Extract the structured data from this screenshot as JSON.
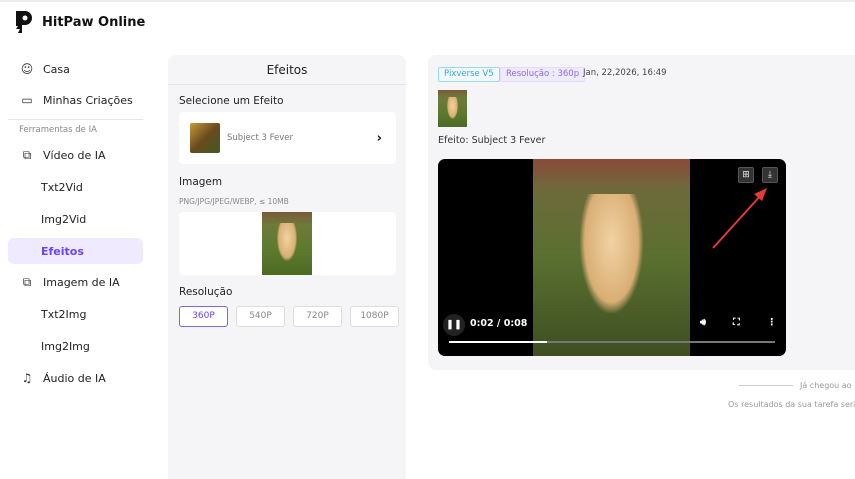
{
  "app": {
    "name": "HitPaw Online"
  },
  "sidebar": {
    "items": [
      {
        "label": "Casa",
        "icon": "home-face-icon"
      },
      {
        "label": "Minhas Criações",
        "icon": "folder-icon"
      }
    ],
    "section_label": "Ferramentas de IA",
    "tools": [
      {
        "label": "Vídeo de IA",
        "icon": "video-ai-icon"
      },
      {
        "label": "Txt2Vid"
      },
      {
        "label": "Img2Vid"
      },
      {
        "label": "Efeitos",
        "active": true
      },
      {
        "label": "Imagem de IA",
        "icon": "image-ai-icon"
      },
      {
        "label": "Txt2Img"
      },
      {
        "label": "Img2Img"
      },
      {
        "label": "Áudio de IA",
        "icon": "music-note-icon"
      }
    ]
  },
  "panel": {
    "title": "Efeitos",
    "select_label": "Selecione um Efeito",
    "effect_name": "Subject 3 Fever",
    "image_label": "Imagem",
    "image_hint": "PNG/JPG/JPEG/WEBP, ≤ 10MB",
    "resolution_label": "Resolução",
    "resolutions": [
      "360P",
      "540P",
      "720P",
      "1080P"
    ],
    "selected_resolution": "360P"
  },
  "result": {
    "model_tag": "Pixverse V5",
    "resolution_tag": "Resolução : 360p",
    "date": "Jan, 22,2026, 16:49",
    "effect_text": "Efeito: Subject 3 Fever",
    "video": {
      "time": "0:02 / 0:08",
      "progress": 0.3
    }
  },
  "footer": {
    "end_text": "Já chegou ao",
    "note": "Os resultados da sua tarefa serã"
  },
  "colors": {
    "accent": "#6a45ef",
    "annotation_arrow": "#e53935"
  }
}
